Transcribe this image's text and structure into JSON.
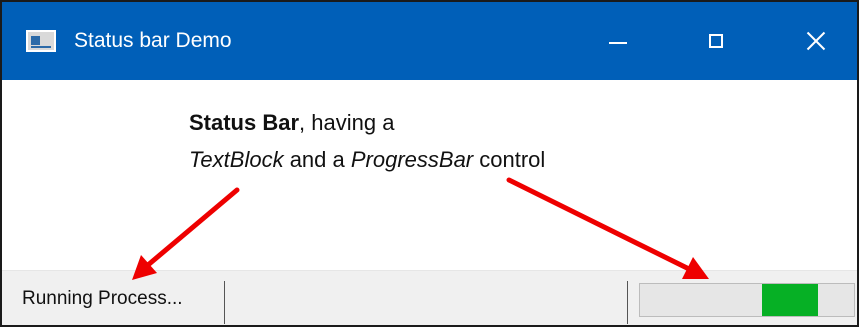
{
  "window": {
    "title": "Status bar Demo",
    "title_bar_color": "#005fb8",
    "icon": "app-window-icon",
    "controls": {
      "minimize_icon": "minimize-icon",
      "maximize_icon": "maximize-icon",
      "close_icon": "close-icon"
    }
  },
  "caption": {
    "bold_text": "Status Bar",
    "line1_rest": ", having a",
    "italic_text_block": "TextBlock",
    "line2_middle": " and a ",
    "italic_progress_bar": "ProgressBar",
    "line2_end": " control"
  },
  "status_bar": {
    "text": "Running Process...",
    "progress": {
      "indeterminate": true,
      "segment_start_fraction": 0.57,
      "segment_end_fraction": 0.83,
      "fill_color": "#06b025"
    }
  },
  "annotations": {
    "arrow_color": "#ee0000",
    "arrows": [
      "arrow-to-text-block",
      "arrow-to-progress-bar"
    ]
  }
}
